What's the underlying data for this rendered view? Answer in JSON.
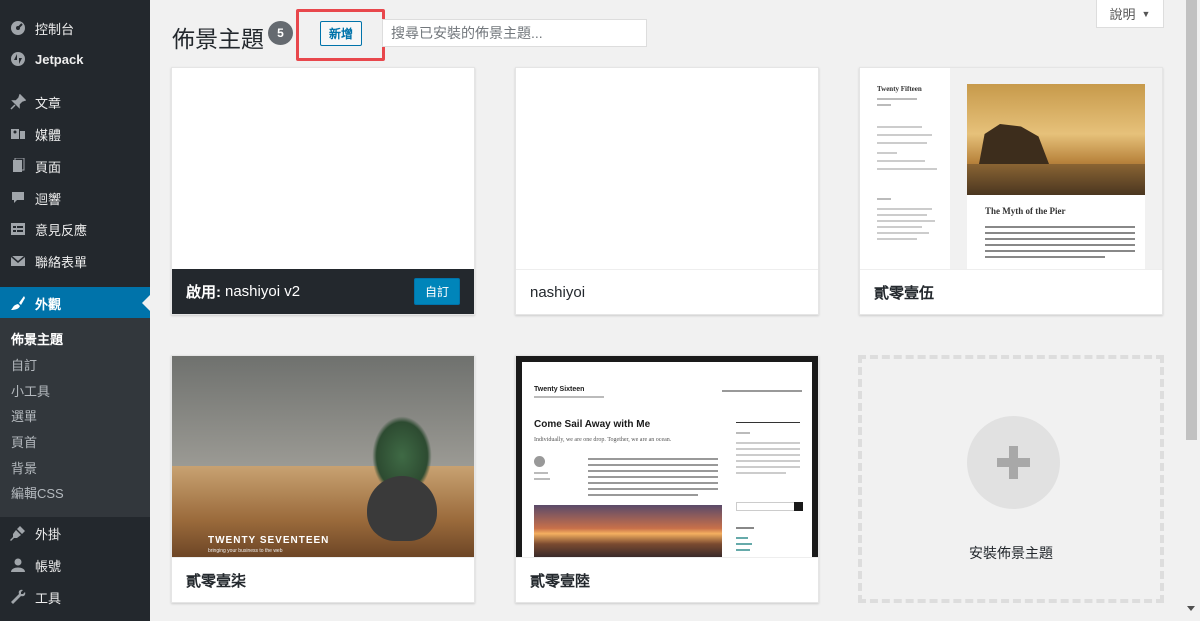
{
  "sidebar": {
    "items": [
      {
        "label": "控制台",
        "icon": "dashboard-icon"
      },
      {
        "label": "Jetpack",
        "icon": "jetpack-icon"
      },
      {
        "label": "文章",
        "icon": "pin-icon"
      },
      {
        "label": "媒體",
        "icon": "media-icon"
      },
      {
        "label": "頁面",
        "icon": "page-icon"
      },
      {
        "label": "迴響",
        "icon": "comment-icon"
      },
      {
        "label": "意見反應",
        "icon": "feedback-icon"
      },
      {
        "label": "聯絡表單",
        "icon": "mail-icon"
      },
      {
        "label": "外觀",
        "icon": "brush-icon"
      },
      {
        "label": "外掛",
        "icon": "plugin-icon"
      },
      {
        "label": "帳號",
        "icon": "user-icon"
      },
      {
        "label": "工具",
        "icon": "wrench-icon"
      }
    ],
    "submenu": [
      "佈景主題",
      "自訂",
      "小工具",
      "選單",
      "頁首",
      "背景",
      "編輯CSS"
    ]
  },
  "header": {
    "title": "佈景主題",
    "count": "5",
    "add_new_label": "新增",
    "search_placeholder": "搜尋已安裝的佈景主題...",
    "help_label": "說明",
    "help_arrow": "▼"
  },
  "themes": [
    {
      "name": "nashiyoi v2",
      "active_prefix": "啟用:",
      "customize_label": "自訂"
    },
    {
      "name": "nashiyoi"
    },
    {
      "name": "貳零壹伍",
      "shot_title": "Twenty Fifteen",
      "shot_post": "The Myth of the Pier"
    },
    {
      "name": "貳零壹柒",
      "shot_title": "TWENTY SEVENTEEN",
      "shot_sub": "bringing your business to the web"
    },
    {
      "name": "貳零壹陸",
      "shot_title": "Twenty Sixteen",
      "shot_post": "Come Sail Away with Me",
      "shot_intro": "Individually, we are one drop. Together, we are an ocean."
    }
  ],
  "add_theme": {
    "label": "安裝佈景主題"
  },
  "colors": {
    "accent": "#0073aa",
    "sidebar_bg": "#23282d",
    "highlight": "#e8474c"
  }
}
